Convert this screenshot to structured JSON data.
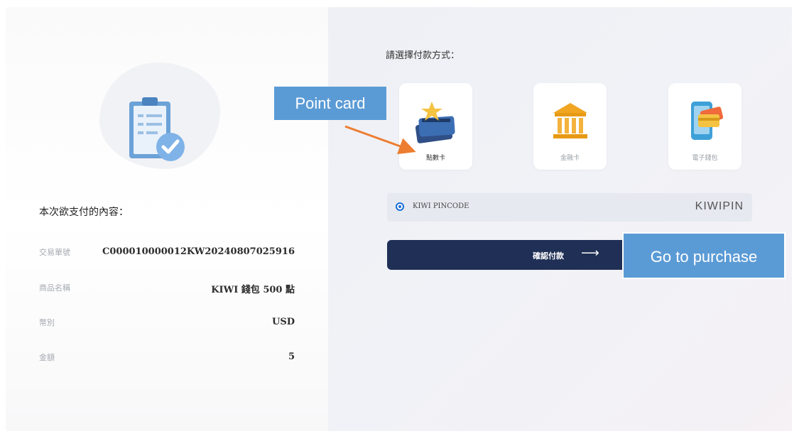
{
  "left": {
    "section_title": "本次欲支付的內容：",
    "rows": [
      {
        "label": "交易單號",
        "value": "C000010000012KW20240807025916"
      },
      {
        "label": "商品名稱",
        "value": "KIWI 錢包 500 點"
      },
      {
        "label": "幣別",
        "value": "USD"
      },
      {
        "label": "金額",
        "value": "5"
      }
    ]
  },
  "right": {
    "choose_title": "請選擇付款方式：",
    "methods": [
      {
        "label": "點數卡",
        "icon": "point-card-icon"
      },
      {
        "label": "金融卡",
        "icon": "bank-icon"
      },
      {
        "label": "電子錢包",
        "icon": "e-wallet-icon"
      }
    ],
    "option": {
      "label": "KIWI PINCODE",
      "logo": "KIWIPIN",
      "selected": true
    },
    "confirm_label": "確認付款"
  },
  "annotations": {
    "point_card": "Point card",
    "go_purchase": "Go to purchase"
  },
  "colors": {
    "primary_button": "#1f2f55",
    "callout": "#5b9bd5",
    "radio": "#1a6fd8",
    "arrow": "#ed7d31"
  }
}
